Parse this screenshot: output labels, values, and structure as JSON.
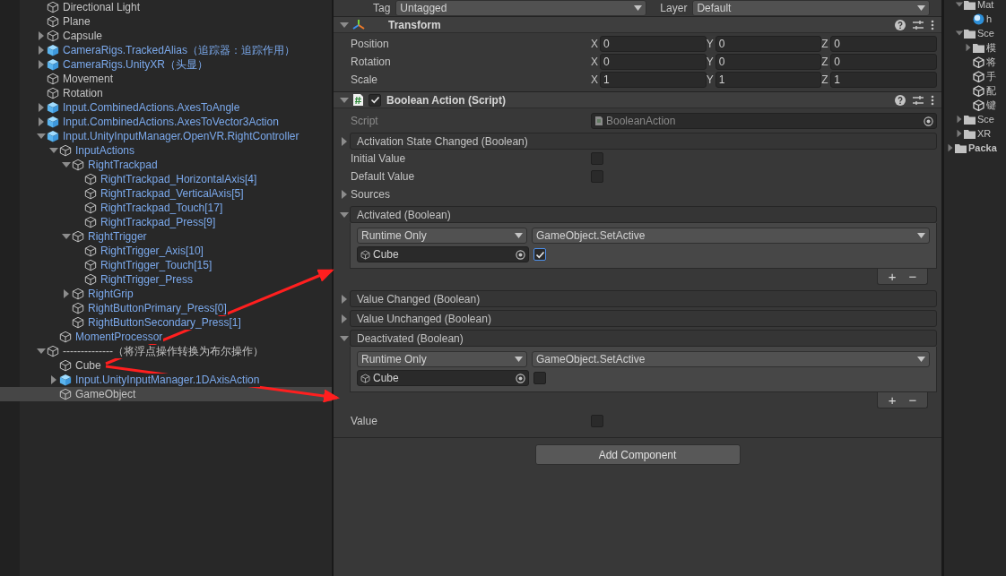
{
  "hierarchy": {
    "items": [
      {
        "kind": "object",
        "label": "Directional Light",
        "selected": false
      },
      {
        "kind": "object",
        "label": "Plane",
        "selected": false
      },
      {
        "kind": "object",
        "label": "Capsule",
        "expanded": false,
        "selected": false
      },
      {
        "kind": "prefab",
        "label": "CameraRigs.TrackedAlias（追踪器：追踪作用）",
        "expanded": false,
        "selected": false
      },
      {
        "kind": "prefab",
        "label": "CameraRigs.UnityXR（头显）",
        "expanded": false,
        "selected": false
      },
      {
        "kind": "object",
        "label": "Movement",
        "selected": false
      },
      {
        "kind": "object",
        "label": "Rotation",
        "selected": false
      },
      {
        "kind": "prefab",
        "label": "Input.CombinedActions.AxesToAngle",
        "expanded": false,
        "selected": false
      },
      {
        "kind": "prefab",
        "label": "Input.CombinedActions.AxesToVector3Action",
        "expanded": false,
        "selected": false
      },
      {
        "kind": "prefab",
        "label": "Input.UnityInputManager.OpenVR.RightController",
        "expanded": true,
        "selected": false,
        "children": [
          {
            "kind": "prefab-part",
            "label": "InputActions",
            "expanded": true,
            "selected": false,
            "children": [
              {
                "kind": "prefab-part",
                "label": "RightTrackpad",
                "expanded": true,
                "selected": false,
                "children": [
                  {
                    "kind": "prefab-part",
                    "label": "RightTrackpad_HorizontalAxis[4]",
                    "selected": false
                  },
                  {
                    "kind": "prefab-part",
                    "label": "RightTrackpad_VerticalAxis[5]",
                    "selected": false
                  },
                  {
                    "kind": "prefab-part",
                    "label": "RightTrackpad_Touch[17]",
                    "selected": false
                  },
                  {
                    "kind": "prefab-part",
                    "label": "RightTrackpad_Press[9]",
                    "selected": false
                  }
                ]
              },
              {
                "kind": "prefab-part",
                "label": "RightTrigger",
                "expanded": true,
                "selected": false,
                "children": [
                  {
                    "kind": "prefab-part",
                    "label": "RightTrigger_Axis[10]",
                    "selected": false
                  },
                  {
                    "kind": "prefab-part",
                    "label": "RightTrigger_Touch[15]",
                    "selected": false
                  },
                  {
                    "kind": "prefab-part",
                    "label": "RightTrigger_Press",
                    "selected": false
                  }
                ]
              },
              {
                "kind": "prefab-part",
                "label": "RightGrip",
                "expanded": false,
                "selected": false
              },
              {
                "kind": "prefab-part",
                "label": "RightButtonPrimary_Press[0]",
                "selected": false
              },
              {
                "kind": "prefab-part",
                "label": "RightButtonSecondary_Press[1]",
                "selected": false
              }
            ]
          },
          {
            "kind": "prefab-part",
            "label": "MomentProcessor",
            "selected": false
          }
        ]
      },
      {
        "kind": "object",
        "label": "--------------（将浮点操作转换为布尔操作）",
        "expanded": true,
        "selected": false,
        "children": [
          {
            "kind": "object",
            "label": "Cube",
            "selected": false
          },
          {
            "kind": "prefab",
            "label": "Input.UnityInputManager.1DAxisAction",
            "expanded": false,
            "selected": false
          },
          {
            "kind": "object",
            "label": "GameObject",
            "selected": true
          }
        ]
      }
    ]
  },
  "inspector": {
    "tag_label": "Tag",
    "tag": "Untagged",
    "layer_label": "Layer",
    "layer": "Default",
    "components": [
      {
        "kind": "transform",
        "title": "Transform",
        "expanded": true,
        "rows": [
          {
            "label": "Position",
            "values": [
              {
                "axis": "X",
                "value": "0"
              },
              {
                "axis": "Y",
                "value": "0"
              },
              {
                "axis": "Z",
                "value": "0"
              }
            ]
          },
          {
            "label": "Rotation",
            "values": [
              {
                "axis": "X",
                "value": "0"
              },
              {
                "axis": "Y",
                "value": "0"
              },
              {
                "axis": "Z",
                "value": "0"
              }
            ]
          },
          {
            "label": "Scale",
            "values": [
              {
                "axis": "X",
                "value": "1"
              },
              {
                "axis": "Y",
                "value": "1"
              },
              {
                "axis": "Z",
                "value": "1"
              }
            ]
          }
        ]
      },
      {
        "kind": "script",
        "title": "Boolean Action (Script)",
        "enabled": true,
        "expanded": true,
        "fields": [
          {
            "kind": "object",
            "label": "Script",
            "value": "BooleanAction",
            "disabled": true
          },
          {
            "kind": "event",
            "label": "Activation State Changed (Boolean)",
            "expanded": false
          },
          {
            "kind": "checkbox",
            "label": "Initial Value",
            "checked": false
          },
          {
            "kind": "checkbox",
            "label": "Default Value",
            "checked": false
          },
          {
            "kind": "foldout",
            "label": "Sources",
            "expanded": false
          },
          {
            "kind": "event",
            "label": "Activated (Boolean)",
            "expanded": true,
            "add": "+",
            "remove": "−",
            "entries": [
              {
                "mode": "Runtime Only",
                "function": "GameObject.SetActive",
                "target": "Cube",
                "checked": true
              }
            ]
          },
          {
            "kind": "event",
            "label": "Value Changed (Boolean)",
            "expanded": false
          },
          {
            "kind": "event",
            "label": "Value Unchanged (Boolean)",
            "expanded": false
          },
          {
            "kind": "event",
            "label": "Deactivated (Boolean)",
            "expanded": true,
            "add": "+",
            "remove": "−",
            "entries": [
              {
                "mode": "Runtime Only",
                "function": "GameObject.SetActive",
                "target": "Cube",
                "checked": false
              }
            ]
          },
          {
            "kind": "checkbox",
            "label": "Value",
            "checked": false
          }
        ]
      }
    ],
    "add_button": "Add Component"
  },
  "project": {
    "items": [
      {
        "kind": "folder",
        "label": "Mat",
        "expanded": true,
        "children": [
          {
            "kind": "material",
            "label": "h"
          }
        ]
      },
      {
        "kind": "folder",
        "label": "Sce",
        "expanded": true,
        "children": [
          {
            "kind": "folder",
            "label": "模",
            "expanded": false
          },
          {
            "kind": "scene",
            "label": "将"
          },
          {
            "kind": "scene",
            "label": "手"
          },
          {
            "kind": "scene",
            "label": "配"
          },
          {
            "kind": "scene",
            "label": "键"
          }
        ]
      },
      {
        "kind": "folder",
        "label": "Sce",
        "expanded": false
      },
      {
        "kind": "folder",
        "label": "XR",
        "expanded": false
      }
    ],
    "packages": {
      "label": "Packa",
      "expanded": false
    }
  }
}
